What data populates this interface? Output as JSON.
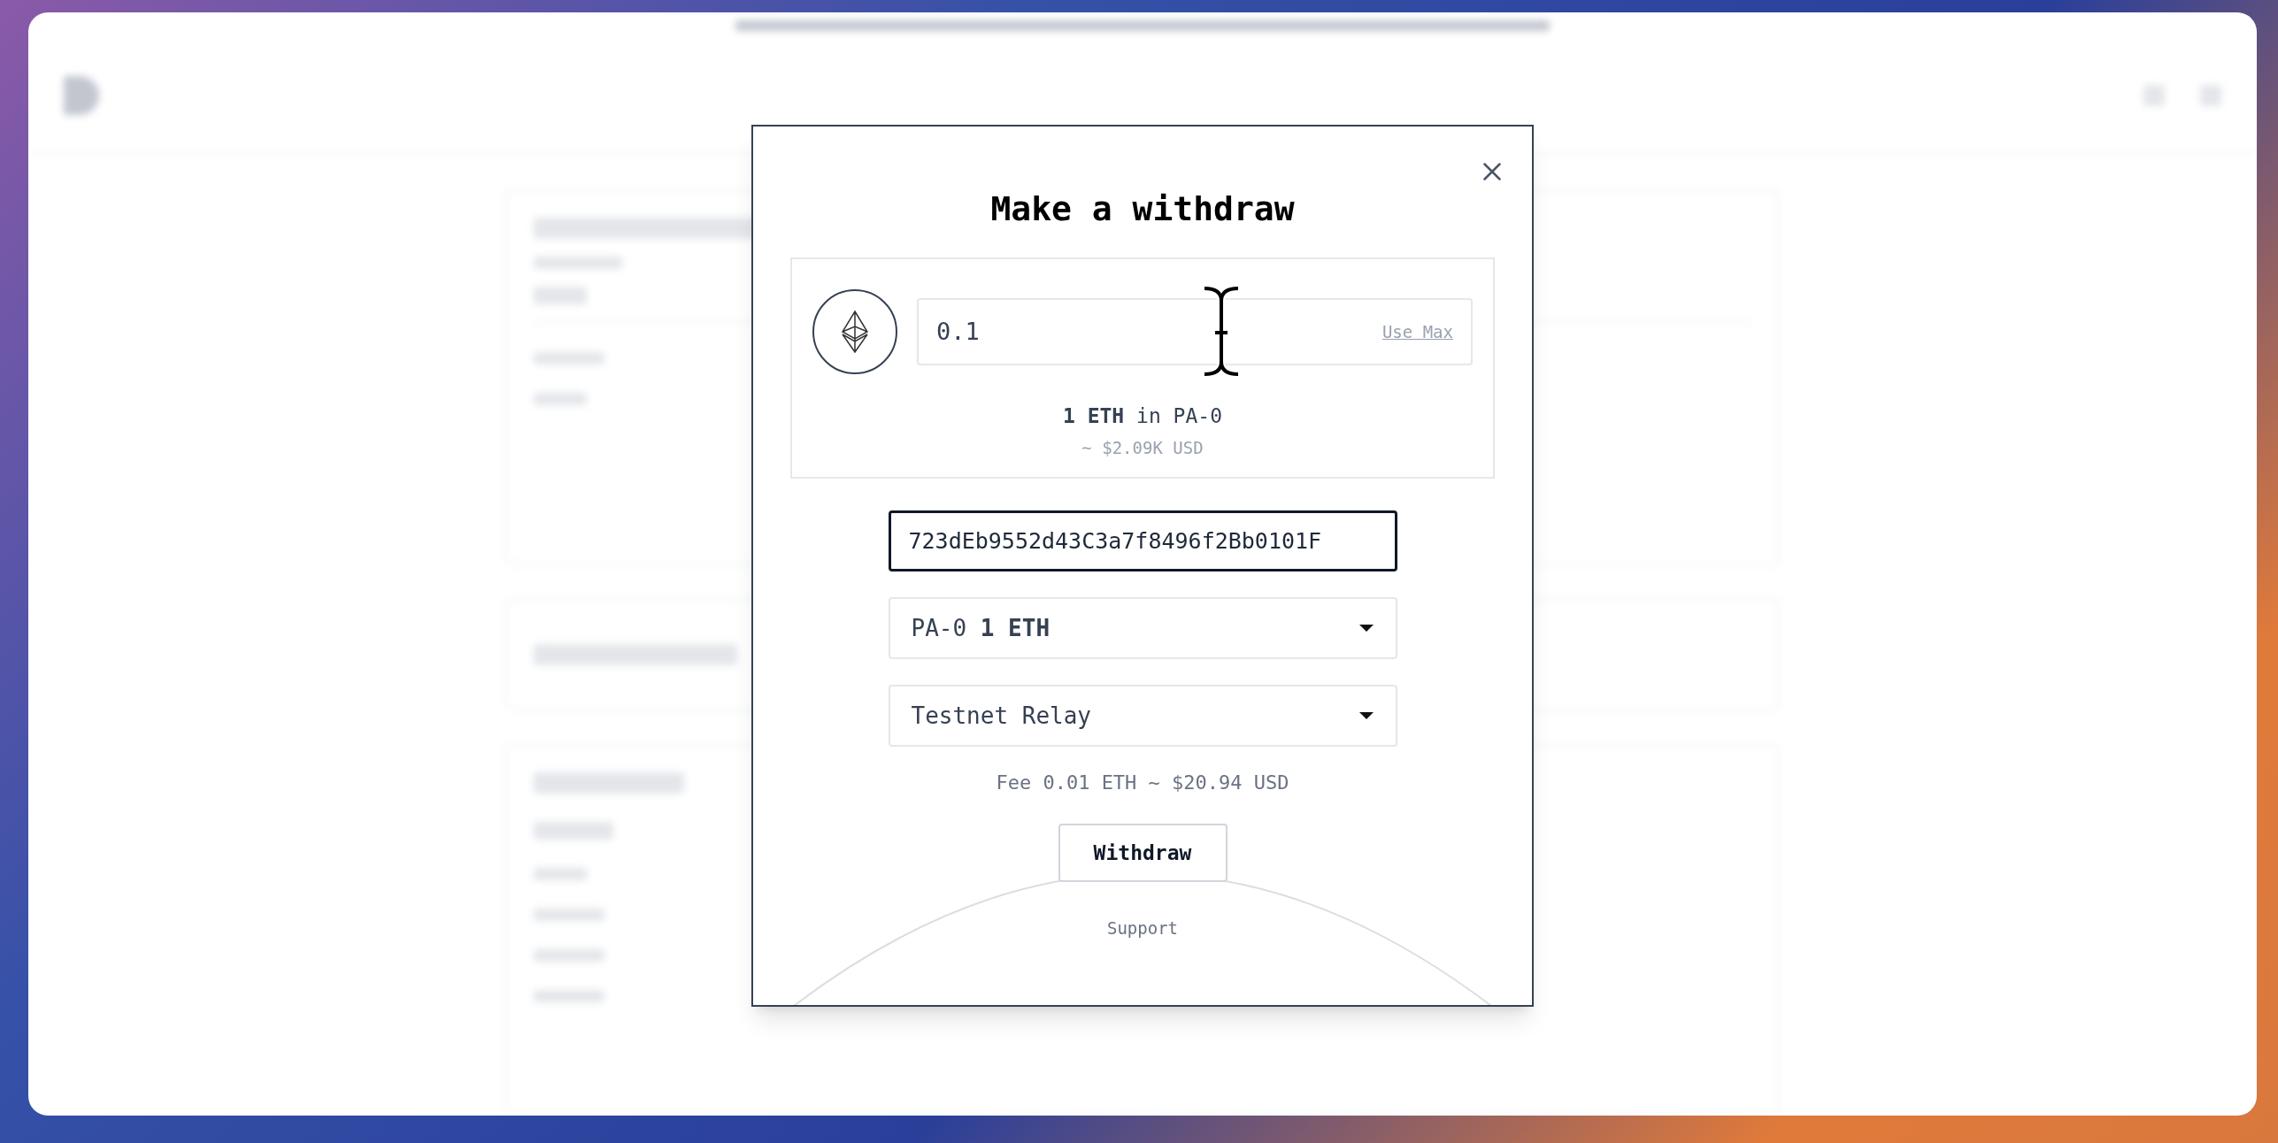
{
  "modal": {
    "title": "Make a withdraw",
    "amount": {
      "value": "0.1",
      "action": "Use Max"
    },
    "balance": "**1 ETH** in PA-0",
    "balance_usd": "~ $2.09K USD",
    "address": {
      "value": "723dEb9552d43C3a7f8496f2Bb0101F",
      "focused": true
    },
    "selects": [
      {
        "label": "PA-0 **1 ETH**"
      },
      {
        "label": "Testnet Relay"
      }
    ],
    "fee": "Fee 0.01 ETH ~ $20.94 USD",
    "submit": "Withdraw",
    "support": "Support"
  }
}
